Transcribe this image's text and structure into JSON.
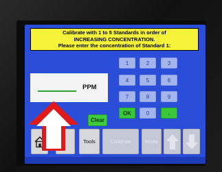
{
  "banner": {
    "line1": "Calibrate with 1 to 5 Standards in order of",
    "line2": "INCREASING CONCENTRATION.",
    "line3": "Please enter the concentration of Standard 1:"
  },
  "entry": {
    "value": "",
    "unit": "PPM"
  },
  "keypad": {
    "keys": [
      "1",
      "2",
      "3",
      "4",
      "5",
      "6",
      "7",
      "8",
      "9",
      "OK",
      "0",
      "."
    ]
  },
  "actions": {
    "clear_label": "Clear"
  },
  "toolbar": {
    "home_icon": "home-icon",
    "tools_label": "Tools",
    "calibrate_label": "Calibrate",
    "mode_label": "Mode",
    "up_icon": "arrow-up-icon",
    "down_icon": "arrow-down-icon"
  },
  "colors": {
    "screen_bg": "#2b4ed8",
    "banner_bg": "#f6f23a",
    "key_bg": "#a4b5ee",
    "key_green": "#39c83a",
    "entry_underline": "#2aa035",
    "overlay_arrow": "#e0191b"
  }
}
